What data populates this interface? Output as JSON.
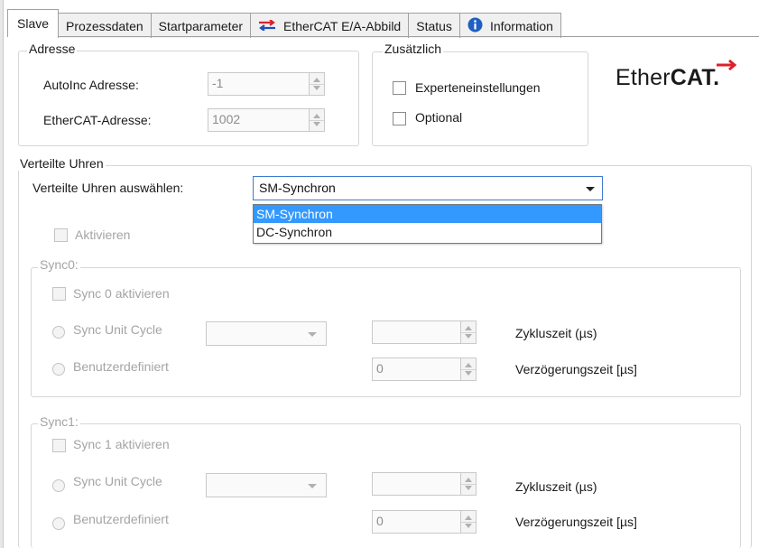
{
  "tabs": [
    {
      "label": "Slave",
      "active": true
    },
    {
      "label": "Prozessdaten"
    },
    {
      "label": "Startparameter"
    },
    {
      "label": "EtherCAT E/A-Abbild",
      "icon": "exchange-arrows-icon"
    },
    {
      "label": "Status"
    },
    {
      "label": "Information",
      "icon": "info-icon"
    }
  ],
  "adresse": {
    "title": "Adresse",
    "autoinc_label": "AutoInc Adresse:",
    "autoinc_value": "-1",
    "ethercat_label": "EtherCAT-Adresse:",
    "ethercat_value": "1002"
  },
  "zusaetzlich": {
    "title": "Zusätzlich",
    "experten_label": "Experteneinstellungen",
    "optional_label": "Optional"
  },
  "logo": {
    "text_normal": "Ether",
    "text_bold": "CAT."
  },
  "verteilte_uhren": {
    "title": "Verteilte Uhren",
    "select_label": "Verteilte Uhren auswählen:",
    "selected": "SM-Synchron",
    "options": [
      "SM-Synchron",
      "DC-Synchron"
    ],
    "aktivieren_label": "Aktivieren"
  },
  "sync0": {
    "title": "Sync0:",
    "enable_label": "Sync 0 aktivieren",
    "unit_cycle_label": "Sync Unit Cycle",
    "custom_label": "Benutzerdefiniert",
    "cycle_time_label": "Zykluszeit (µs)",
    "delay_label": "Verzögerungszeit [µs]",
    "delay_value": "0"
  },
  "sync1": {
    "title": "Sync1:",
    "enable_label": "Sync 1 aktivieren",
    "unit_cycle_label": "Sync Unit Cycle",
    "custom_label": "Benutzerdefiniert",
    "cycle_time_label": "Zykluszeit (µs)",
    "delay_label": "Verzögerungszeit [µs]",
    "delay_value": "0"
  },
  "colors": {
    "accent": "#3399ff",
    "disabled_text": "#a4a4a4",
    "ethercat_red": "#d9232d",
    "exchange_blue": "#1f4fb5"
  }
}
